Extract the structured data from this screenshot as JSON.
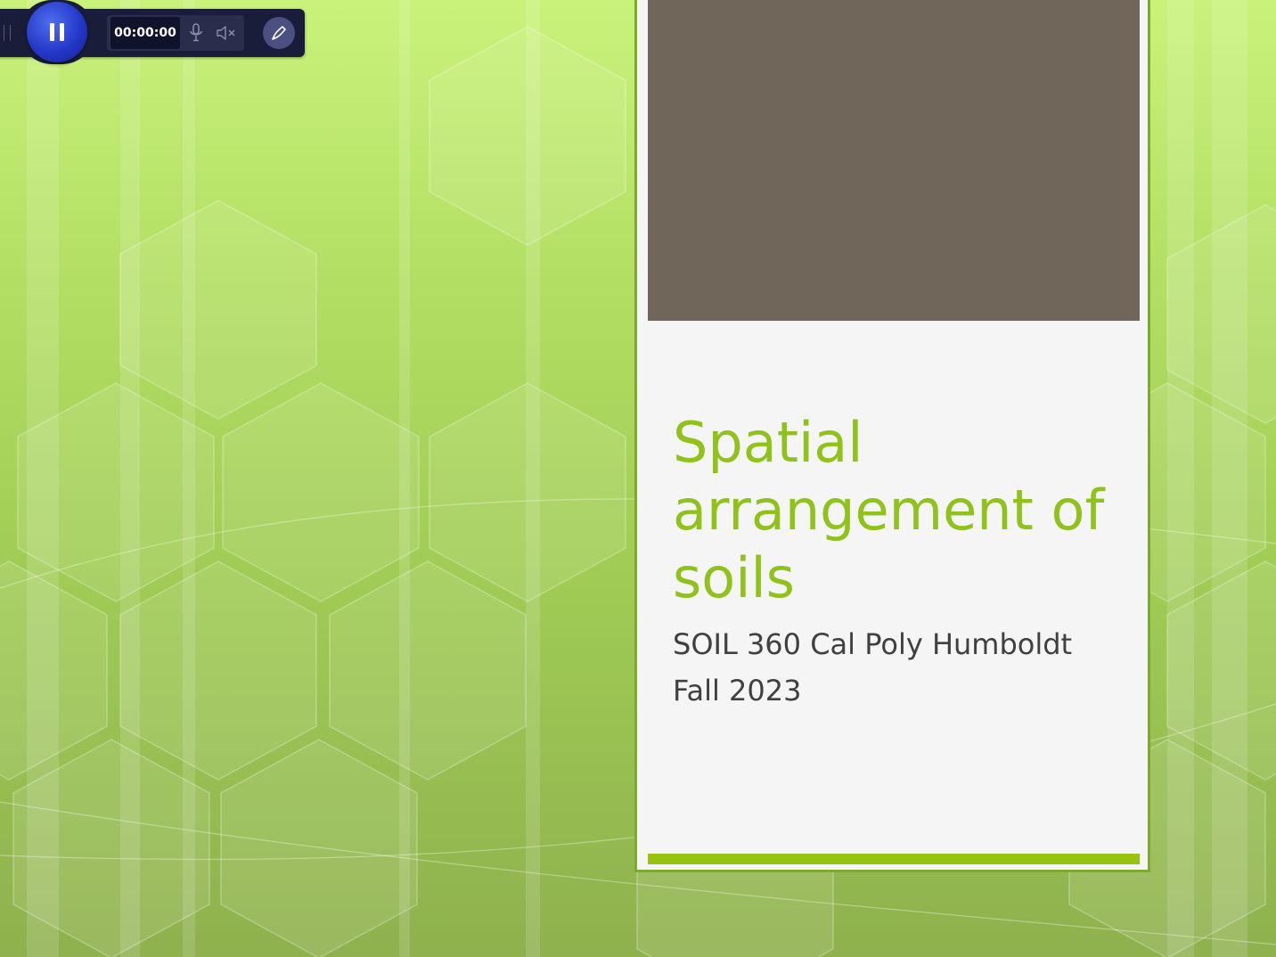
{
  "recorder": {
    "timer": "00:00:00",
    "icons": [
      "drag-handle",
      "pause-icon",
      "microphone-icon",
      "speaker-muted-icon",
      "pen-icon"
    ]
  },
  "slide": {
    "title": "Spatial arrangement of soils",
    "subtitle_line1": "SOIL 360 Cal Poly Humboldt",
    "subtitle_line2": "Fall 2023"
  },
  "colors": {
    "title": "#8fc21a",
    "subtitle": "#404040",
    "accent_bar": "#97c20f",
    "image_placeholder": "#70665a",
    "card_border": "#7fa82e",
    "recorder_bg": "#1a1d3a",
    "pause_button": "#2438c8"
  }
}
